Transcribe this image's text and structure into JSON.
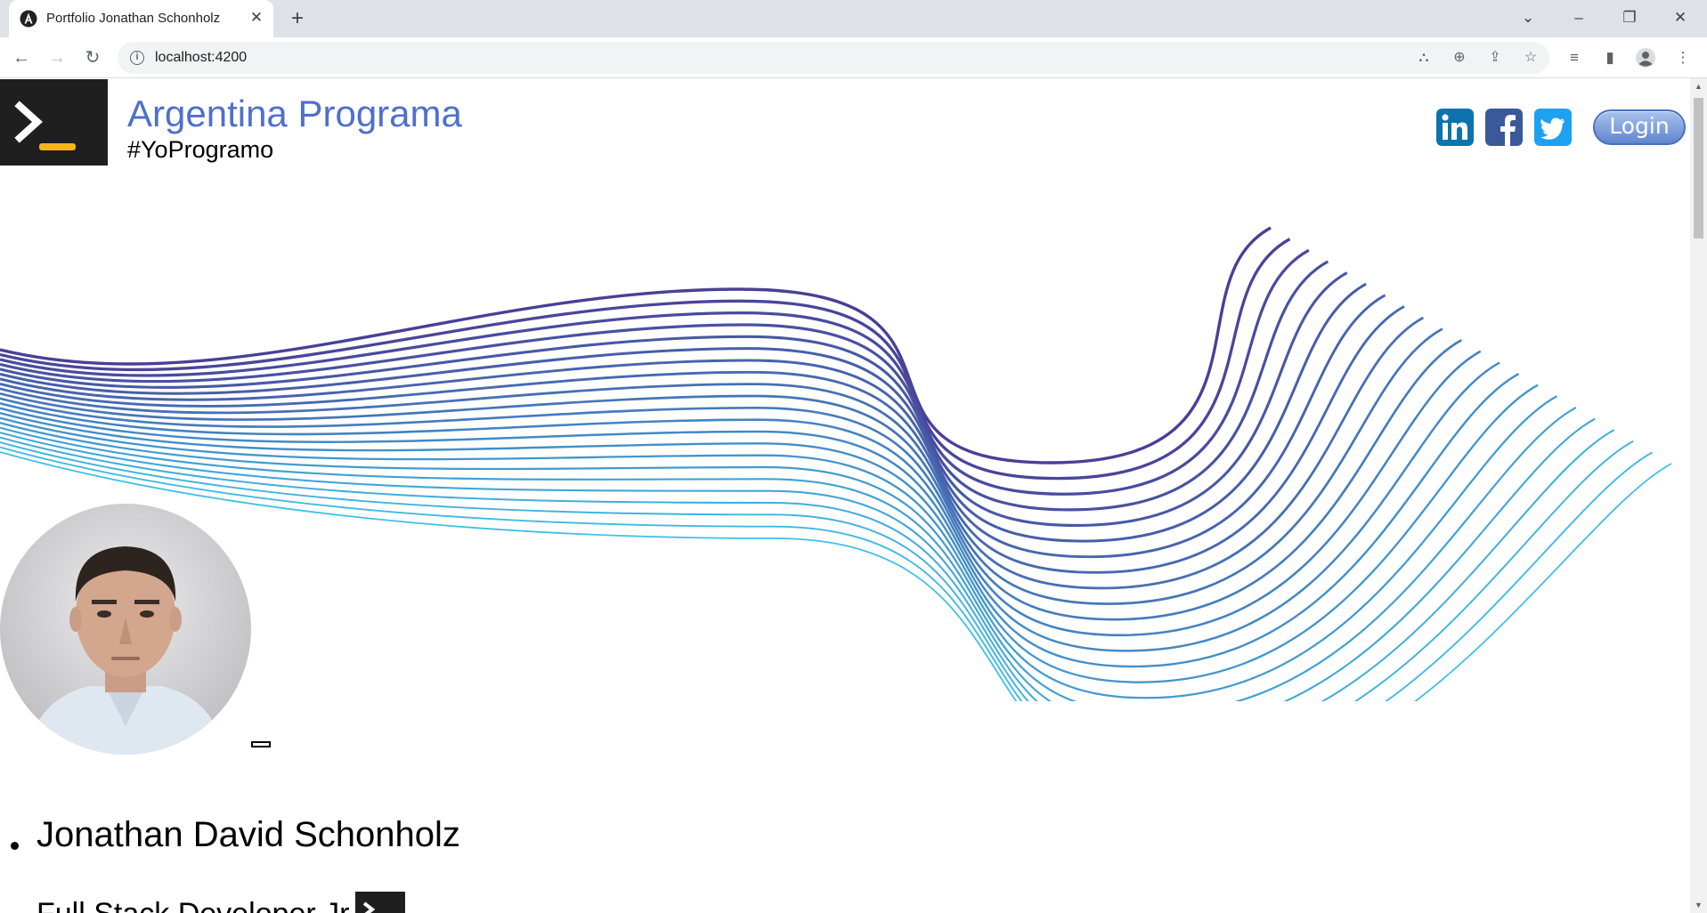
{
  "browser": {
    "tab_title": "Portfolio Jonathan Schonholz",
    "url": "localhost:4200"
  },
  "header": {
    "title": "Argentina Programa",
    "subtitle": "#YoProgramo",
    "login_label": "Login",
    "social_icons": [
      "linkedin-icon",
      "facebook-icon",
      "twitter-icon"
    ]
  },
  "profile": {
    "name": "Jonathan David Schonholz",
    "role": "Full Stack Developer Jr"
  },
  "colors": {
    "brand_blue": "#4f6fce",
    "wave_top": "#4a3f96",
    "wave_bottom": "#3fc0e6",
    "logo_bg": "#1f1f1f",
    "logo_accent": "#f6b31a"
  }
}
